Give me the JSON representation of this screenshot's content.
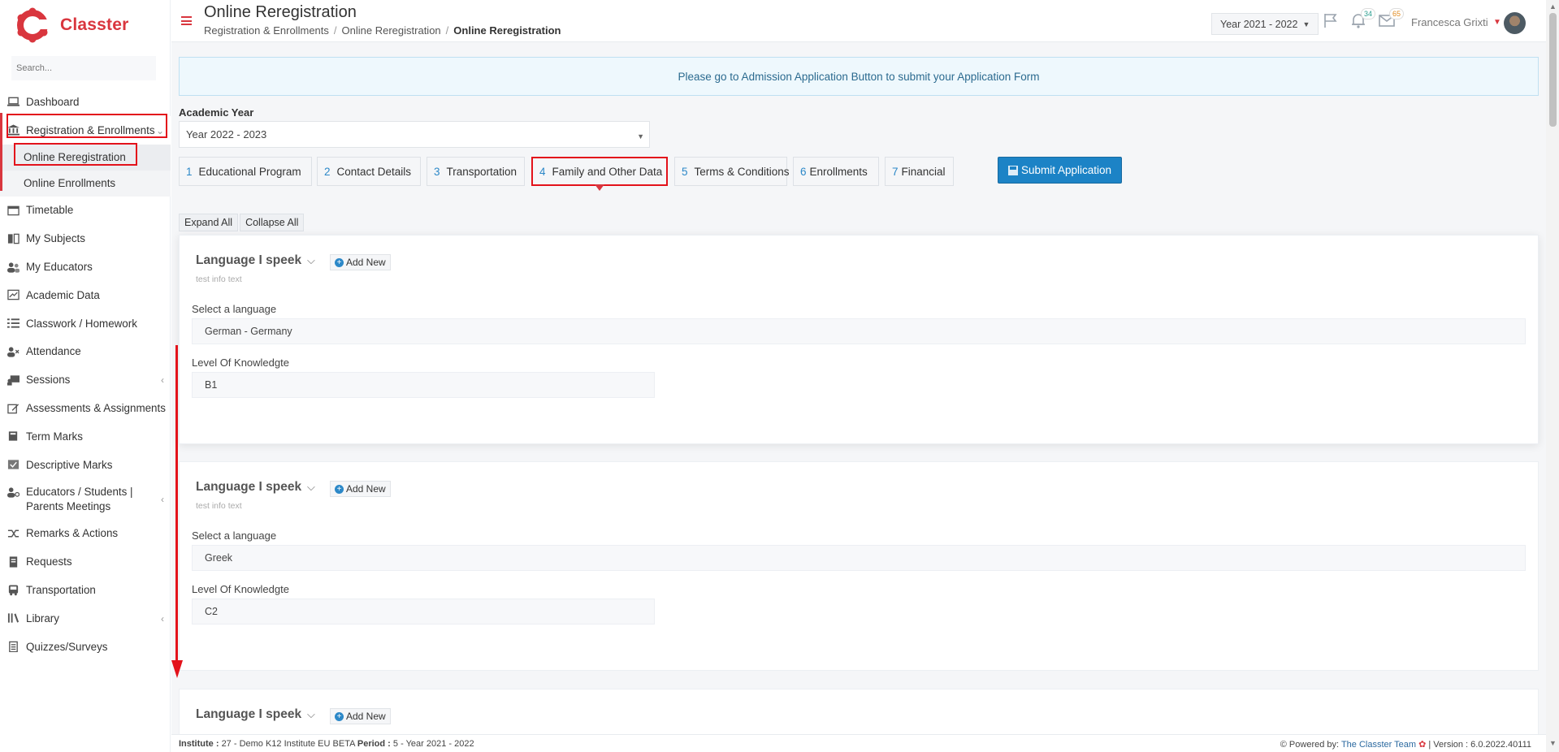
{
  "app": {
    "name": "Classter",
    "brand_color": "#d9363e",
    "accent_color": "#1c83c6"
  },
  "sidebar": {
    "search_placeholder": "Search...",
    "items": [
      {
        "label": "Dashboard",
        "icon": "laptop-icon"
      },
      {
        "label": "Registration & Enrollments",
        "icon": "institution-icon"
      },
      {
        "label": "Timetable",
        "icon": "calendar-icon"
      },
      {
        "label": "My Subjects",
        "icon": "book-icon"
      },
      {
        "label": "My Educators",
        "icon": "users-icon"
      },
      {
        "label": "Academic Data",
        "icon": "chart-icon"
      },
      {
        "label": "Classwork / Homework",
        "icon": "list-icon"
      },
      {
        "label": "Attendance",
        "icon": "user-x-icon"
      },
      {
        "label": "Sessions",
        "icon": "presentation-icon"
      },
      {
        "label": "Assessments & Assignments",
        "icon": "edit-icon"
      },
      {
        "label": "Term Marks",
        "icon": "book-stack-icon"
      },
      {
        "label": "Descriptive Marks",
        "icon": "chart-check-icon"
      },
      {
        "label": "Educators / Students | Parents Meetings",
        "icon": "user-gear-icon"
      },
      {
        "label": "Remarks & Actions",
        "icon": "shuffle-icon"
      },
      {
        "label": "Requests",
        "icon": "document-icon"
      },
      {
        "label": "Transportation",
        "icon": "bus-icon"
      },
      {
        "label": "Library",
        "icon": "library-icon"
      },
      {
        "label": "Quizzes/Surveys",
        "icon": "clipboard-icon"
      }
    ],
    "subitems": [
      {
        "label": "Online Reregistration"
      },
      {
        "label": "Online Enrollments"
      }
    ]
  },
  "header": {
    "title": "Online Reregistration",
    "breadcrumb": [
      "Registration & Enrollments",
      "Online Reregistration",
      "Online Reregistration"
    ],
    "year_selector": "Year 2021 - 2022",
    "notifications_count": "34",
    "messages_count": "65",
    "user_name": "Francesca Grixti"
  },
  "notice": "Please go to Admission Application Button to submit your Application Form",
  "academic_year": {
    "label": "Academic Year",
    "value": "Year 2022 - 2023"
  },
  "steps": [
    {
      "num": "1",
      "label": "Educational Program"
    },
    {
      "num": "2",
      "label": "Contact Details"
    },
    {
      "num": "3",
      "label": "Transportation"
    },
    {
      "num": "4",
      "label": "Family and Other Data"
    },
    {
      "num": "5",
      "label": "Terms & Conditions"
    },
    {
      "num": "6",
      "label": "Enrollments"
    },
    {
      "num": "7",
      "label": "Financial"
    }
  ],
  "submit_label": "Submit Application",
  "expand_all": "Expand All",
  "collapse_all": "Collapse All",
  "cards": [
    {
      "title": "Language I speek",
      "add_new": "Add New",
      "info": "test info text",
      "lang_label": "Select a language",
      "lang_value": "German - Germany",
      "level_label": "Level Of Knowledgte",
      "level_value": "B1"
    },
    {
      "title": "Language I speek",
      "add_new": "Add New",
      "info": "test info text",
      "lang_label": "Select a language",
      "lang_value": "Greek",
      "level_label": "Level Of Knowledgte",
      "level_value": "C2"
    },
    {
      "title": "Language I speek",
      "add_new": "Add New"
    }
  ],
  "footer": {
    "institute_label": "Institute :",
    "institute_value": "27 - Demo K12 Institute EU BETA",
    "period_label": "Period :",
    "period_value": "5 - Year 2021 - 2022",
    "powered_by": "Powered by:",
    "team": "The Classter Team",
    "version": "| Version : 6.0.2022.40111"
  }
}
